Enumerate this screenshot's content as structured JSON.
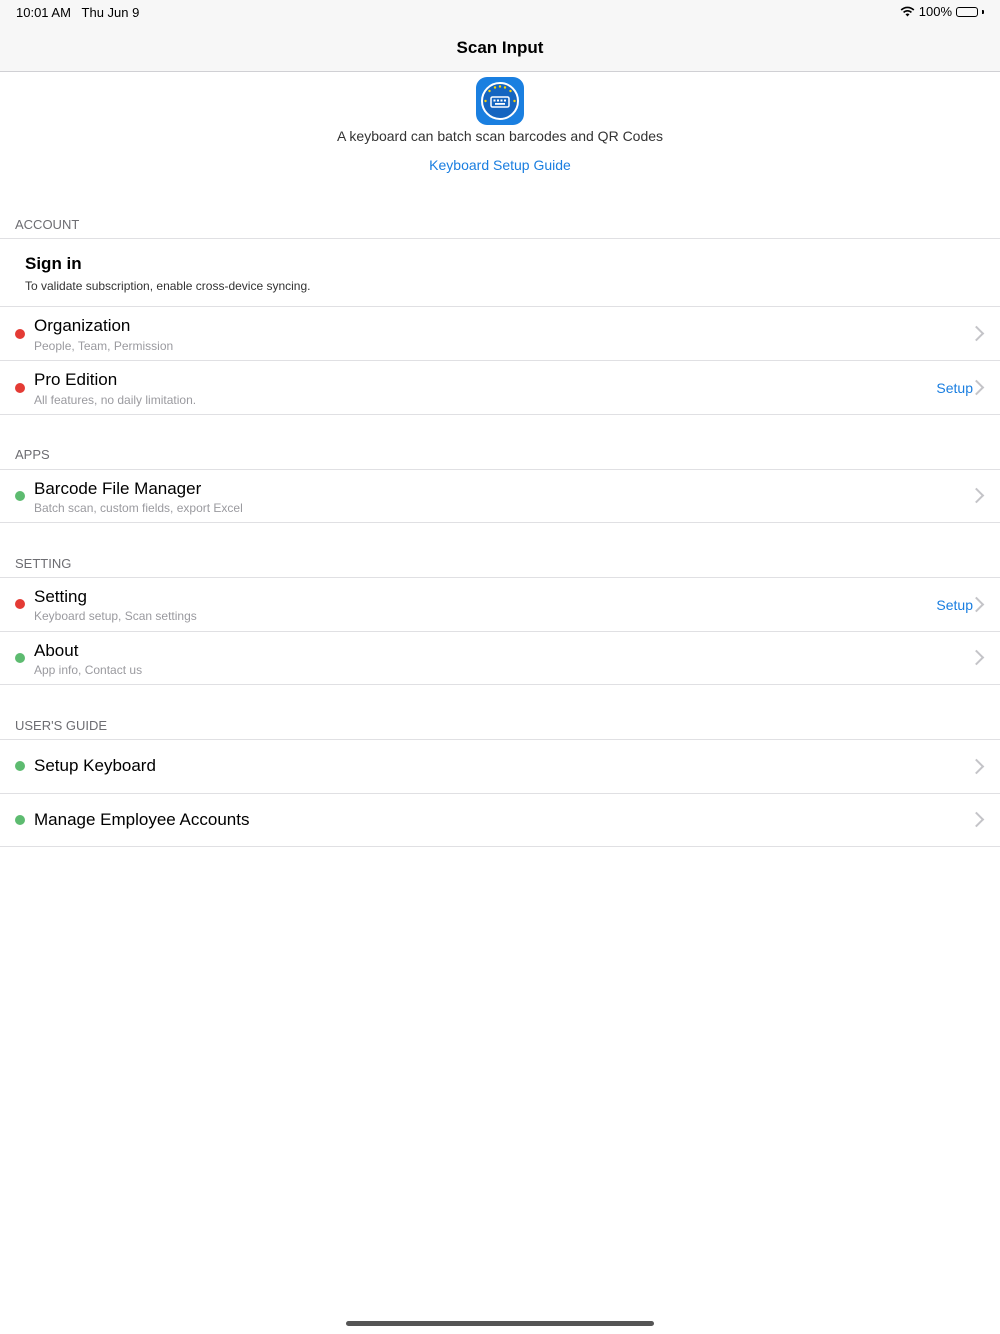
{
  "status_bar": {
    "time": "10:01 AM",
    "date": "Thu Jun 9",
    "battery": "100%",
    "battery_level": 1.0
  },
  "nav": {
    "title": "Scan Input"
  },
  "header": {
    "app_icon": "barcode-keyboard-app-icon",
    "tagline": "A keyboard can batch scan barcodes and QR Codes",
    "guide_link": "Keyboard Setup Guide"
  },
  "sections": {
    "account": {
      "title": "ACCOUNT",
      "signin": {
        "title": "Sign in",
        "subtitle": "To validate subscription, enable cross-device syncing."
      },
      "organization": {
        "title": "Organization",
        "subtitle": "People, Team, Permission",
        "status": "red"
      },
      "pro": {
        "title": "Pro Edition",
        "subtitle": "All features, no daily limitation.",
        "action": "Setup",
        "status": "red"
      }
    },
    "apps": {
      "title": "APPS",
      "barcode_manager": {
        "title": "Barcode File Manager",
        "subtitle": "Batch scan, custom fields, export Excel",
        "status": "green"
      }
    },
    "setting": {
      "title": "SETTING",
      "setting": {
        "title": "Setting",
        "subtitle": "Keyboard setup, Scan settings",
        "action": "Setup",
        "status": "red"
      },
      "about": {
        "title": "About",
        "subtitle": "App info, Contact us",
        "status": "green"
      }
    },
    "guide": {
      "title": "USER'S GUIDE",
      "setup_keyboard": {
        "title": "Setup Keyboard",
        "status": "green"
      },
      "manage_employees": {
        "title": "Manage Employee Accounts",
        "status": "green"
      }
    }
  },
  "colors": {
    "accent": "#1a7ee0",
    "red_status": "#e43b35",
    "green_status": "#5dbb70"
  }
}
